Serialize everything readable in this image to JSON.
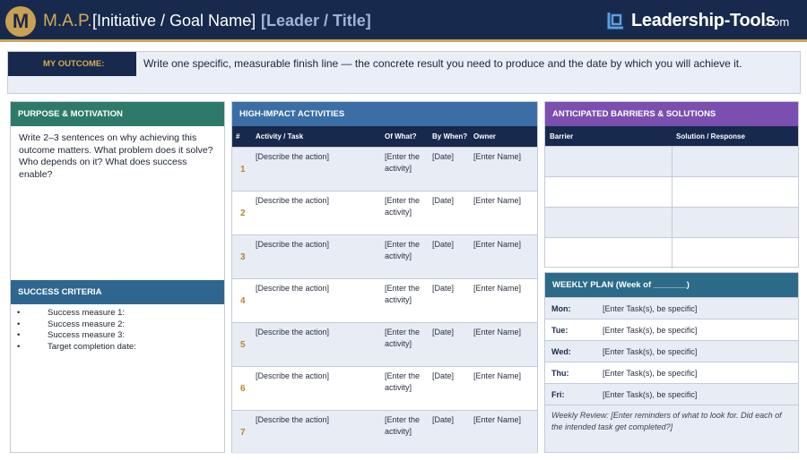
{
  "header": {
    "logo_letter": "M",
    "map": "M.A.P.",
    "initiative": "[Initiative / Goal Name]",
    "separator": "·",
    "leader": "[Leader / Title]",
    "brand_name": "Leadership-Tools",
    "brand_domain": ".com"
  },
  "outcome": {
    "label": "MY OUTCOME:",
    "text": "Write one specific, measurable finish line — the concrete result you need to produce and the date by which you will achieve it."
  },
  "purpose": {
    "title": "PURPOSE & MOTIVATION",
    "text": "Write 2–3 sentences on why achieving this outcome matters. What problem does it solve? Who depends on it? What does success enable?"
  },
  "success": {
    "title": "SUCCESS CRITERIA",
    "bullet": "•",
    "items": [
      "Success measure 1:",
      "Success measure 2:",
      "Success measure 3:",
      "Target completion date:"
    ]
  },
  "activities": {
    "title": "HIGH-IMPACT ACTIVITIES",
    "columns": [
      "#",
      "Activity / Task",
      "Of What?",
      "By When?",
      "Owner"
    ],
    "rows": [
      {
        "num": "1",
        "task": "[Describe the action]",
        "of_what": "[Enter the activity]",
        "by_when": "[Date]",
        "owner": "[Enter Name]"
      },
      {
        "num": "2",
        "task": "[Describe the action]",
        "of_what": "[Enter the activity]",
        "by_when": "[Date]",
        "owner": "[Enter Name]"
      },
      {
        "num": "3",
        "task": "[Describe the action]",
        "of_what": "[Enter the activity]",
        "by_when": "[Date]",
        "owner": "[Enter Name]"
      },
      {
        "num": "4",
        "task": "[Describe the action]",
        "of_what": "[Enter the activity]",
        "by_when": "[Date]",
        "owner": "[Enter Name]"
      },
      {
        "num": "5",
        "task": "[Describe the action]",
        "of_what": "[Enter the activity]",
        "by_when": "[Date]",
        "owner": "[Enter Name]"
      },
      {
        "num": "6",
        "task": "[Describe the action]",
        "of_what": "[Enter the activity]",
        "by_when": "[Date]",
        "owner": "[Enter Name]"
      },
      {
        "num": "7",
        "task": "[Describe the action]",
        "of_what": "[Enter the activity]",
        "by_when": "[Date]",
        "owner": "[Enter Name]"
      }
    ]
  },
  "barriers": {
    "title": "ANTICIPATED BARRIERS & SOLUTIONS",
    "columns": [
      "Barrier",
      "Solution / Response"
    ]
  },
  "weekly": {
    "title": "WEEKLY PLAN  (Week of _______)",
    "days": [
      {
        "day": "Mon:",
        "task": "[Enter Task(s), be specific]"
      },
      {
        "day": "Tue:",
        "task": "[Enter Task(s), be specific]"
      },
      {
        "day": "Wed:",
        "task": "[Enter Task(s), be specific]"
      },
      {
        "day": "Thu:",
        "task": "[Enter Task(s), be specific]"
      },
      {
        "day": "Fri:",
        "task": "[Enter Task(s), be specific]"
      }
    ],
    "review": "Weekly Review: [Enter reminders of what to look for. Did each of the intended task get completed?]"
  },
  "colors": {
    "navy": "#172a4d",
    "gold": "#c9a152",
    "purpose": "#2e7a6a",
    "success": "#2f6690",
    "activities": "#3a6ea5",
    "barriers": "#7a4fb0",
    "weekly": "#2c6b88"
  }
}
